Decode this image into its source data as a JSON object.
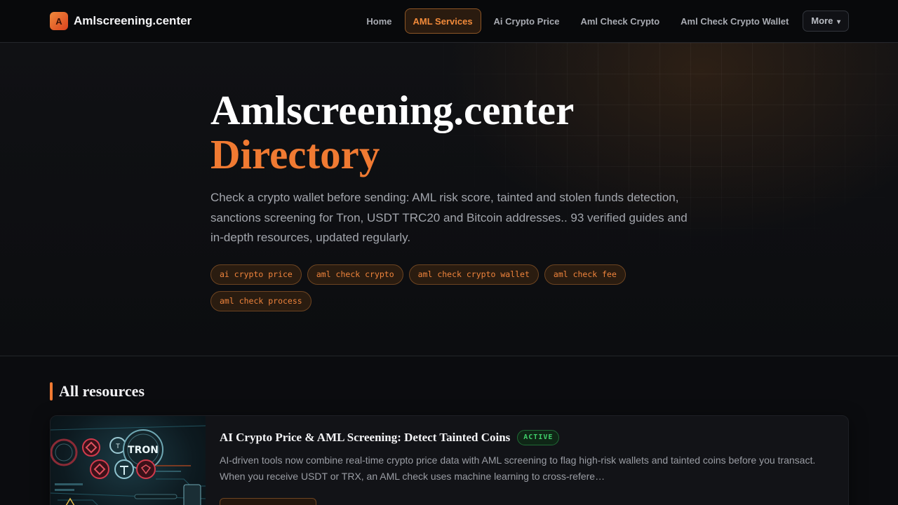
{
  "header": {
    "brand_letter": "A",
    "brand_name": "Amlscreening.center",
    "nav": [
      {
        "label": "Home",
        "active": false
      },
      {
        "label": "AML Services",
        "active": true
      },
      {
        "label": "Ai Crypto Price",
        "active": false
      },
      {
        "label": "Aml Check Crypto",
        "active": false
      },
      {
        "label": "Aml Check Crypto Wallet",
        "active": false
      }
    ],
    "more_label": "More",
    "more_caret": "▾"
  },
  "hero": {
    "title": "Amlscreening.center",
    "title_accent": "Directory",
    "description": "Check a crypto wallet before sending: AML risk score, tainted and stolen funds detection, sanctions screening for Tron, USDT TRC20 and Bitcoin addresses.. 93 verified guides and in-depth resources, updated regularly.",
    "tags": [
      "ai crypto price",
      "aml check crypto",
      "aml check crypto wallet",
      "aml check fee",
      "aml check process"
    ]
  },
  "resources": {
    "section_title": "All resources",
    "cards": [
      {
        "title": "AI Crypto Price & AML Screening: Detect Tainted Coins",
        "status": "ACTIVE",
        "excerpt": "AI-driven tools now combine real-time crypto price data with AML screening to flag high-risk wallets and tainted coins before you transact. When you receive USDT or TRX, an AML check uses machine learning to cross-refere…",
        "thumb_text": "TRON",
        "button_label": ""
      }
    ]
  },
  "colors": {
    "accent": "#f07a32",
    "background": "#0b0c0f",
    "active_badge": "#3fcf6a"
  }
}
